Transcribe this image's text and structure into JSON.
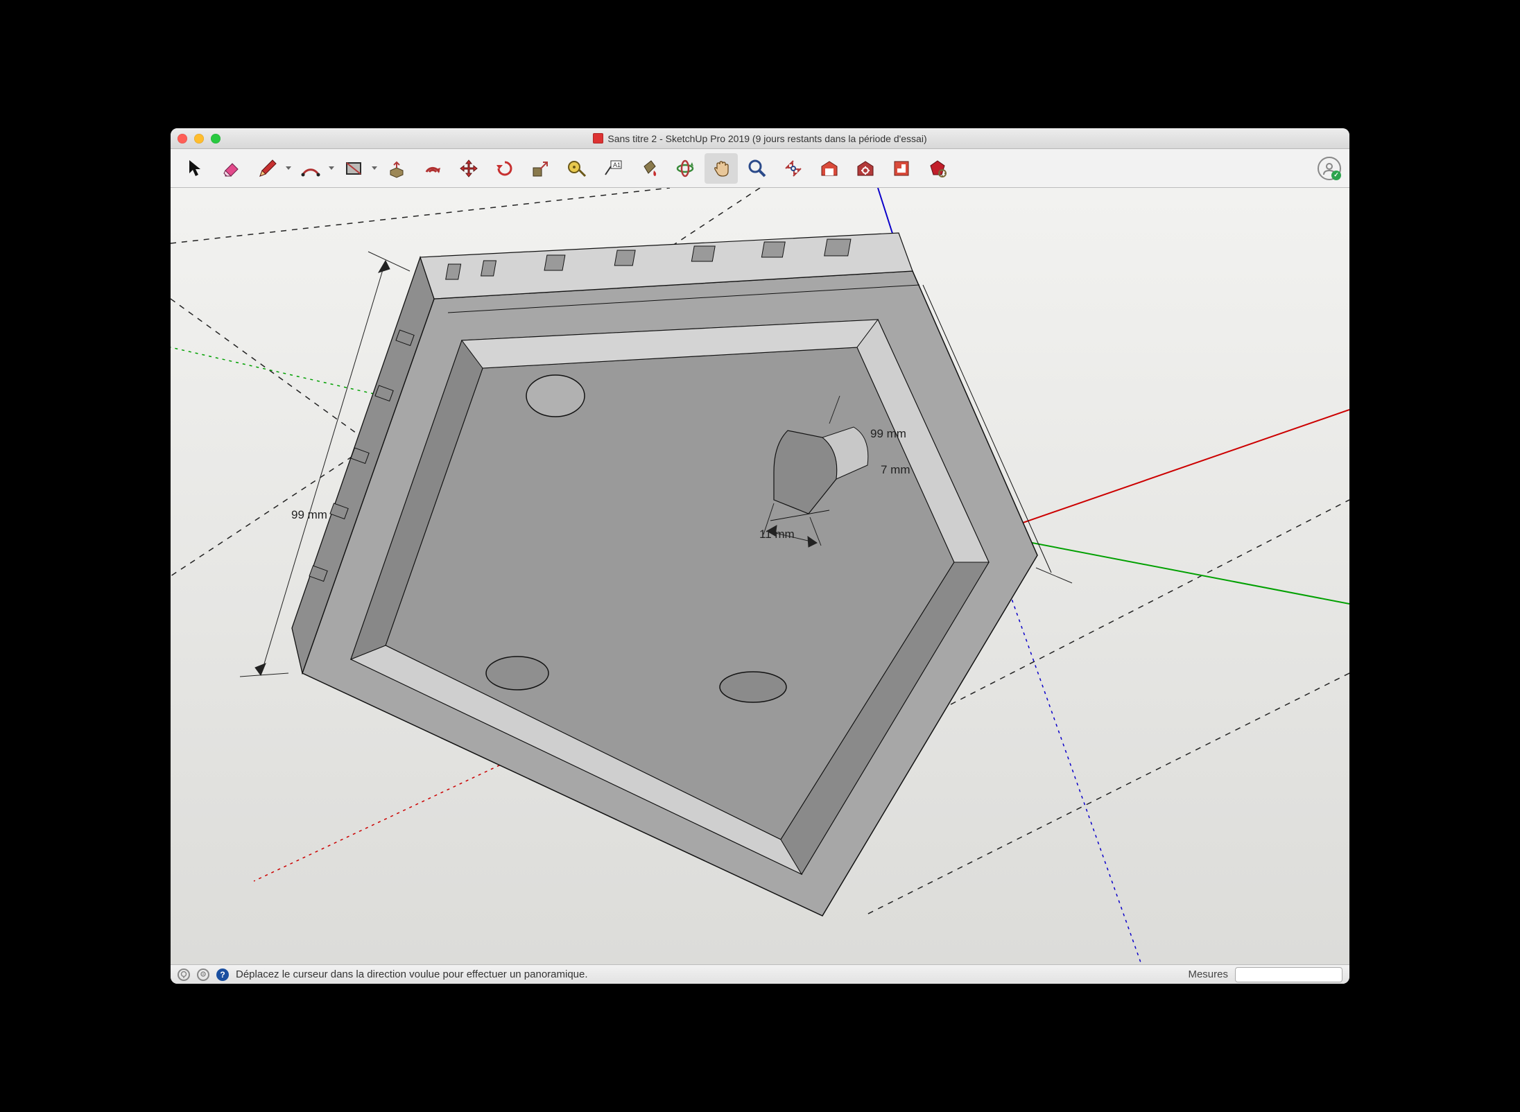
{
  "window": {
    "title": "Sans titre 2 - SketchUp Pro 2019 (9 jours restants dans la période d'essai)"
  },
  "toolbar": {
    "tools": [
      {
        "id": "select",
        "name": "select-arrow-icon"
      },
      {
        "id": "eraser",
        "name": "eraser-icon"
      },
      {
        "id": "pencil",
        "name": "pencil-icon",
        "has_dropdown": true
      },
      {
        "id": "arc",
        "name": "arc-icon",
        "has_dropdown": true
      },
      {
        "id": "rectangle",
        "name": "rectangle-icon",
        "has_dropdown": true
      },
      {
        "id": "push-pull",
        "name": "push-pull-icon"
      },
      {
        "id": "offset",
        "name": "offset-icon"
      },
      {
        "id": "move",
        "name": "move-icon"
      },
      {
        "id": "rotate",
        "name": "rotate-icon"
      },
      {
        "id": "scale",
        "name": "scale-icon"
      },
      {
        "id": "tape",
        "name": "tape-measure-icon"
      },
      {
        "id": "text",
        "name": "text-label-icon"
      },
      {
        "id": "paint",
        "name": "paint-bucket-icon"
      },
      {
        "id": "orbit",
        "name": "orbit-icon"
      },
      {
        "id": "pan",
        "name": "pan-hand-icon",
        "active": true
      },
      {
        "id": "zoom",
        "name": "zoom-icon"
      },
      {
        "id": "zoom-extents",
        "name": "zoom-extents-icon"
      },
      {
        "id": "warehouse",
        "name": "3d-warehouse-icon"
      },
      {
        "id": "extension-warehouse",
        "name": "extension-warehouse-icon"
      },
      {
        "id": "layout",
        "name": "layout-icon"
      },
      {
        "id": "ruby",
        "name": "ruby-console-icon"
      }
    ]
  },
  "dimensions": {
    "left_side": "99 mm",
    "right_top": "99 mm",
    "right_mid": "7 mm",
    "notch": "11 mm"
  },
  "status": {
    "hint": "Déplacez le curseur dans la direction voulue pour effectuer un panoramique.",
    "measures_label": "Mesures",
    "measures_value": ""
  },
  "axes": {
    "x": "red",
    "y": "green",
    "z": "blue"
  }
}
